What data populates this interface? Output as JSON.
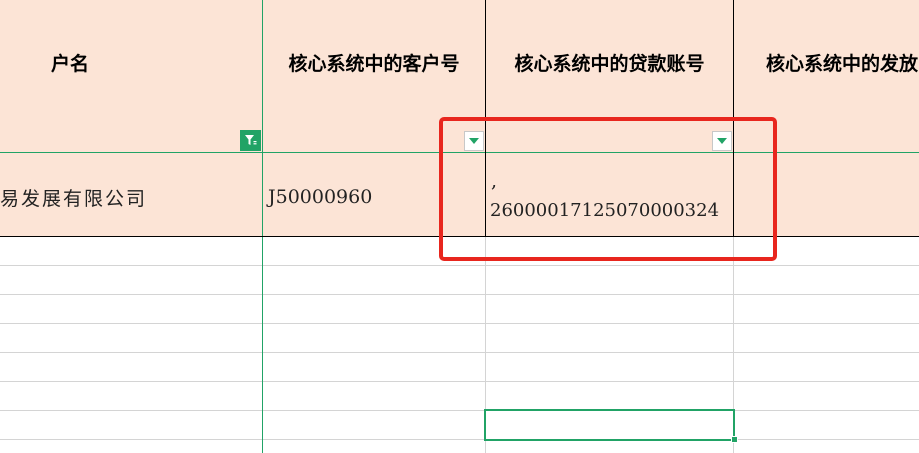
{
  "colors": {
    "header_fill": "#FCE4D6",
    "grid": "#D4D4D4",
    "accent_green": "#21A366",
    "highlight_red": "#E8261E"
  },
  "columns": [
    {
      "header": "户名"
    },
    {
      "header": "核心系统中的客户号"
    },
    {
      "header": "核心系统中的贷款账号"
    },
    {
      "header": "核心系统中的发放"
    }
  ],
  "row1": {
    "name": "易发展有限公司",
    "customer_no": "J50000960",
    "loan_account_line1": ",",
    "loan_account_line2": "26000017125070000324"
  },
  "icons": {
    "filter": "filter-active-icon",
    "dropdown": "dropdown-arrow-icon"
  }
}
